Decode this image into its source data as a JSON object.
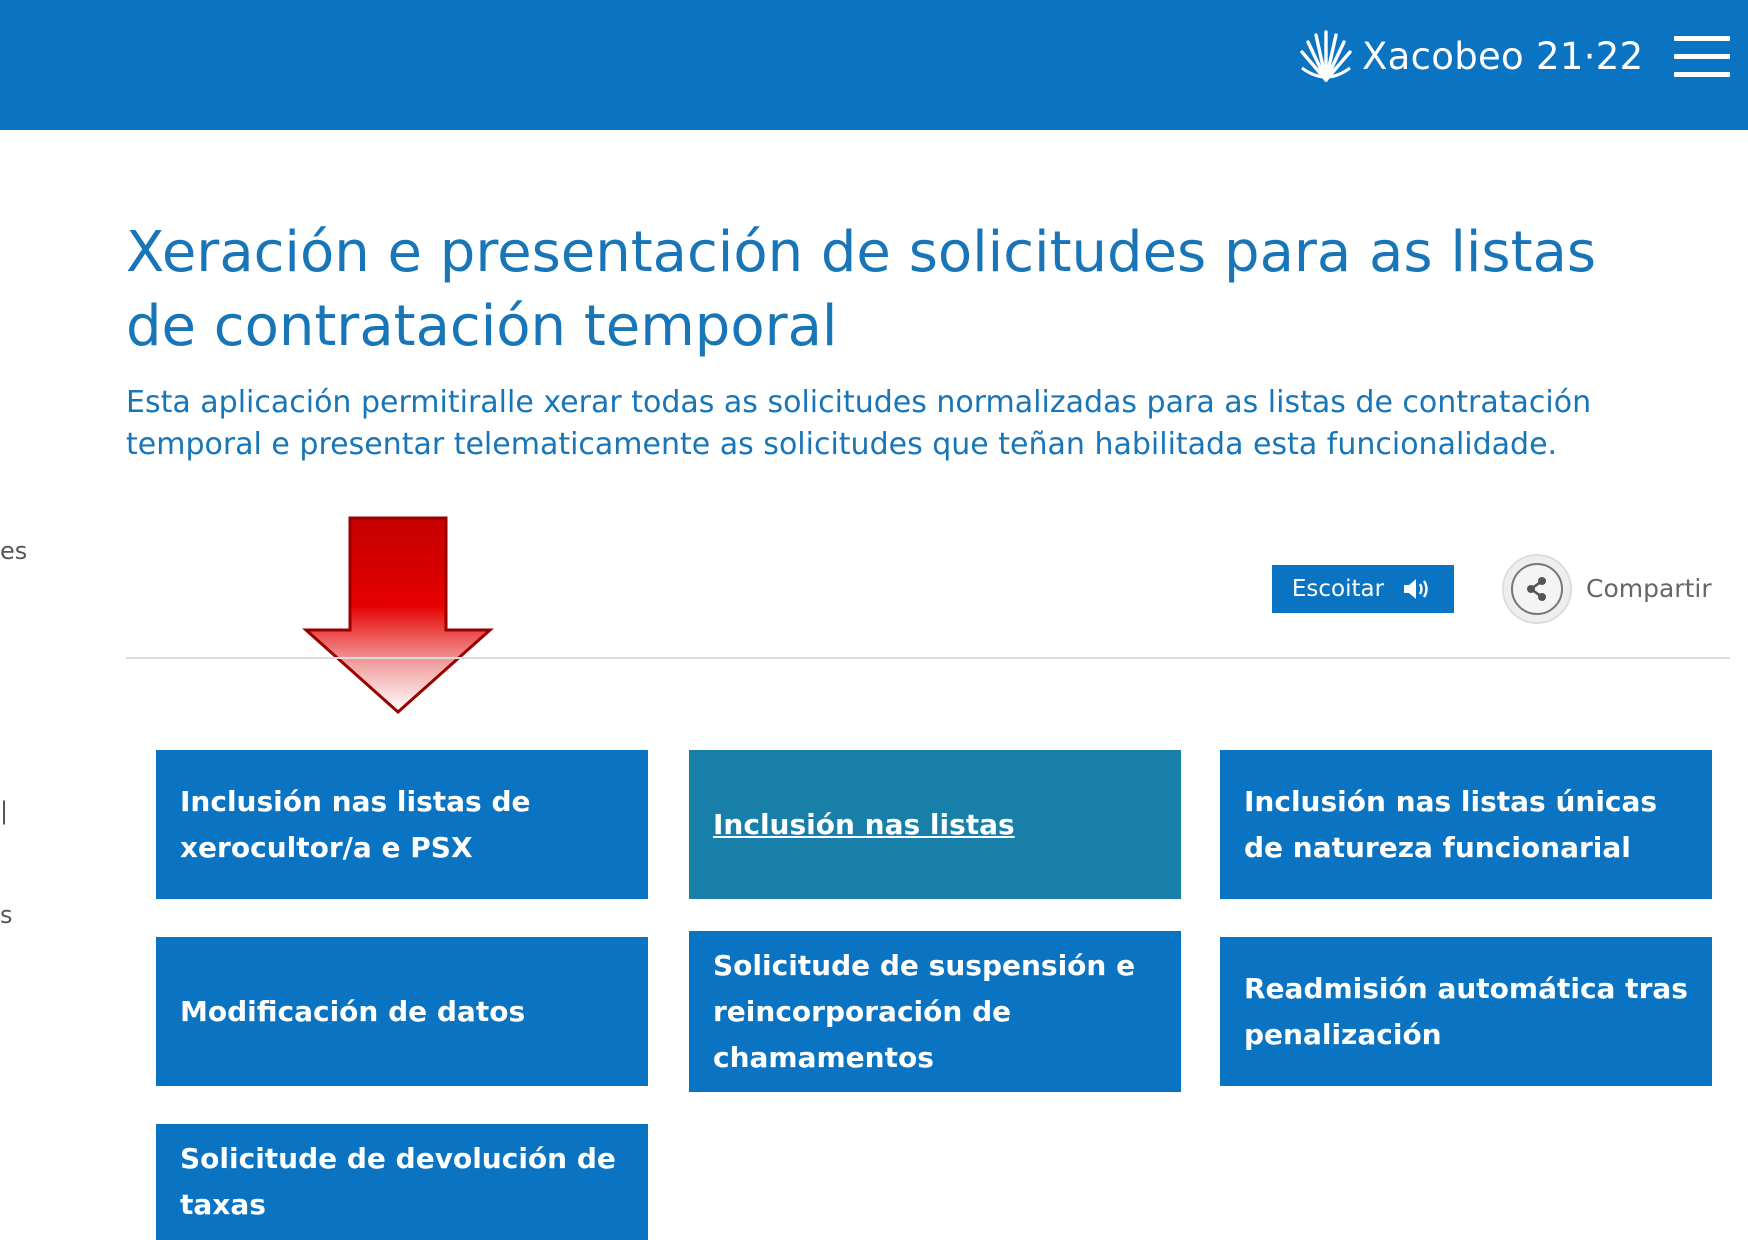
{
  "header": {
    "brand_text": "Xacobeo 21·22",
    "menu_icon": "hamburger-menu-icon",
    "brand_color": "#0a74c2"
  },
  "left_fragments": [
    "es",
    "s"
  ],
  "main": {
    "title": "Xeración e presentación de solicitudes para as listas de contratación temporal",
    "description": "Esta aplicación permitiralle xerar todas as solicitudes normalizadas para as listas de contratación temporal e presentar telematicamente as solicitudes que teñan habilitada esta funcionalidade."
  },
  "toolbar": {
    "listen_label": "Escoitar",
    "listen_icon": "speaker-icon",
    "share_label": "Compartir",
    "share_icon": "share-icon"
  },
  "tiles": [
    {
      "label": "Inclusión nas listas de xerocultor/a e PSX",
      "active": false
    },
    {
      "label": "Inclusión nas listas",
      "active": true
    },
    {
      "label": "Inclusión nas listas únicas de natureza funcionarial",
      "active": false
    },
    {
      "label": "Modificación de datos",
      "active": false
    },
    {
      "label": "Solicitude de suspensión e reincorporación de chamamentos",
      "active": false
    },
    {
      "label": "Readmisión automática tras penalización",
      "active": false
    },
    {
      "label": "Solicitude de devolución de taxas",
      "active": false
    }
  ],
  "colors": {
    "tile": "#0a74c2",
    "tile_active": "#187fa8",
    "arrow": "#d40000"
  }
}
